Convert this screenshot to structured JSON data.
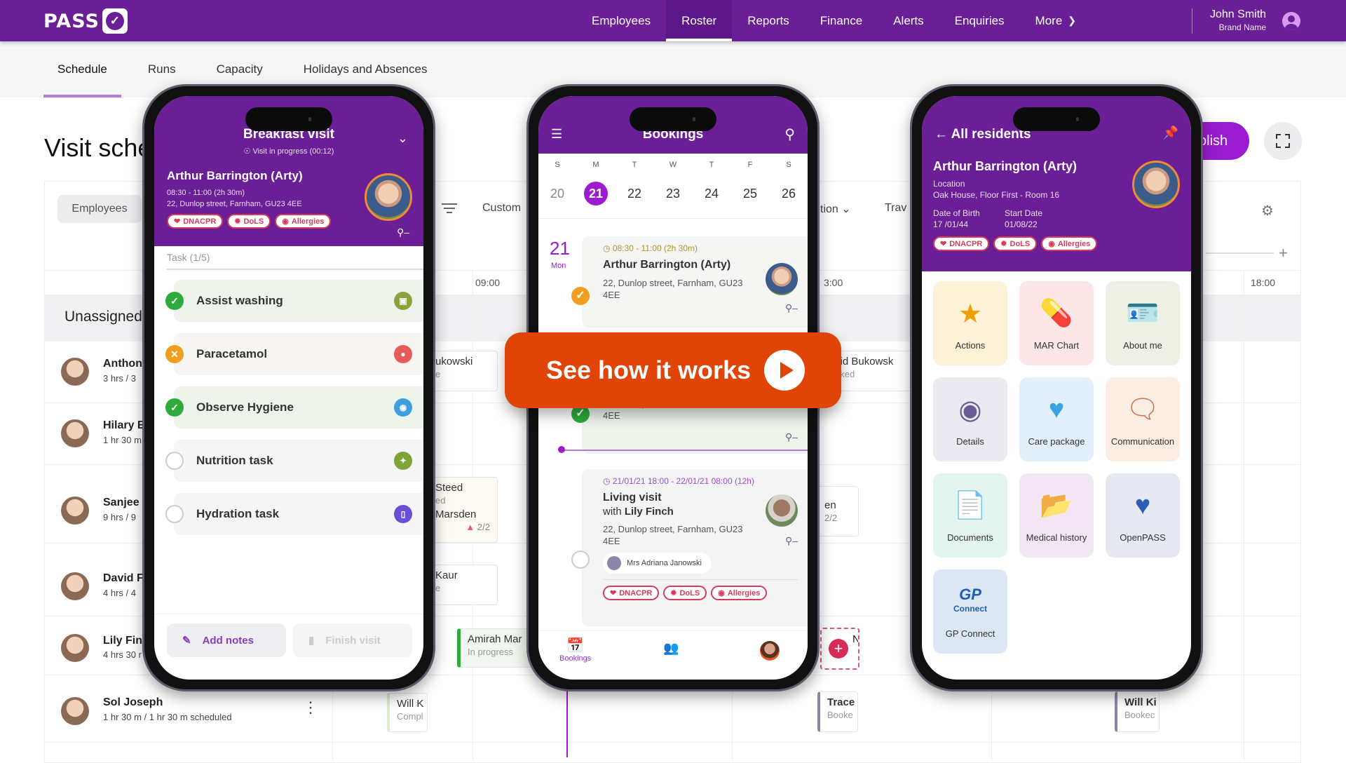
{
  "app": {
    "logo_text": "PASS",
    "logo_mark": "✓"
  },
  "nav": {
    "items": [
      "Employees",
      "Roster",
      "Reports",
      "Finance",
      "Alerts",
      "Enquiries",
      "More"
    ],
    "active": "Roster",
    "more_icon": "chevron-down"
  },
  "user": {
    "name": "John Smith",
    "brand": "Brand Name",
    "icon": "user-circle"
  },
  "tabs": {
    "items": [
      "Schedule",
      "Runs",
      "Capacity",
      "Holidays and Absences"
    ],
    "active": "Schedule"
  },
  "page": {
    "title": "Visit sche",
    "publish_label": "olish",
    "fullscreen_icon": "expand-icon"
  },
  "toolbar": {
    "employees_label": "Employees",
    "customise_label": "Custom",
    "location_label": "tion",
    "travel_label": "Trav"
  },
  "timeline": {
    "labels": [
      "09:00",
      "3:00",
      "18:00"
    ]
  },
  "unassigned_label": "Unassigned",
  "employees": [
    {
      "name": "Anthon",
      "hours": "3 hrs / 3"
    },
    {
      "name": "Hilary E",
      "hours": "1 hr 30 m"
    },
    {
      "name": "Sanjee",
      "hours": "9 hrs / 9"
    },
    {
      "name": "David F",
      "hours": "4 hrs / 4"
    },
    {
      "name": "Lily Fin",
      "hours": "4 hrs 30 r"
    },
    {
      "name": "Sol Joseph",
      "hours": "1 hr 30 m / 1 hr 30 m scheduled"
    }
  ],
  "blocks": {
    "b1": {
      "title": "ukowski",
      "status": "e"
    },
    "b2": {
      "title": "vid Bukowsk",
      "status": "oked"
    },
    "b3": {
      "title": "Steed",
      "status": "ed",
      "title2": "Marsden",
      "count": "2/2"
    },
    "b4": {
      "title": "en",
      "count": "2/2"
    },
    "b5": {
      "title": "Kaur",
      "status": "e"
    },
    "b6": {
      "title": "Amirah Mar",
      "status": "In progress"
    },
    "b7": {
      "title": "N"
    },
    "b8": {
      "title": "Will K",
      "status": "Compl"
    },
    "b9": {
      "title": "Trace",
      "status": "Booke"
    },
    "b10": {
      "title": "Will Ki",
      "status": "Bookec"
    }
  },
  "phone1": {
    "title": "Breakfast visit",
    "status": "Visit in progress (00:12)",
    "client": "Arthur Barrington (Arty)",
    "time": "08:30 - 11:00 (2h 30m)",
    "address": "22, Dunlop street, Farnham, GU23 4EE",
    "chips": [
      "DNACPR",
      "DoLS",
      "Allergies"
    ],
    "task_header": "Task (1/5)",
    "tasks": [
      {
        "label": "Assist washing",
        "state": "done",
        "color": "#8aa33a"
      },
      {
        "label": "Paracetamol",
        "state": "refused",
        "color": "#e85a5a"
      },
      {
        "label": "Observe Hygiene",
        "state": "done-late",
        "color": "#3d9ee0"
      },
      {
        "label": "Nutrition task",
        "state": "pending",
        "color": "#7ea338"
      },
      {
        "label": "Hydration task",
        "state": "pending",
        "color": "#6a4fd6"
      }
    ],
    "add_notes": "Add notes",
    "finish_visit": "Finish visit"
  },
  "phone2": {
    "title": "Bookings",
    "days": [
      "S",
      "M",
      "T",
      "W",
      "T",
      "F",
      "S"
    ],
    "dates": [
      "20",
      "21",
      "22",
      "23",
      "24",
      "25",
      "26"
    ],
    "selected_date": "21",
    "side_day": "21",
    "side_dow": "Mon",
    "booking1": {
      "time": "08:30 - 11:00 (2h 30m)",
      "name": "Arthur Barrington (Arty)",
      "address": "22, Dunlop street, Farnham, GU23 4EE"
    },
    "booking2": {
      "address": "22, Dunlop street, Farnham, GU23 4EE"
    },
    "booking3": {
      "time": "21/01/21 18:00 - 22/01/21 08:00 (12h)",
      "title": "Living visit",
      "with_prefix": "with ",
      "with_name": "Lily Finch",
      "address": "22, Dunlop street, Farnham, GU23 4EE",
      "carer": "Mrs Adriana Janowski",
      "chips": [
        "DNACPR",
        "DoLS",
        "Allergies"
      ]
    },
    "bottom_nav": {
      "bookings": "Bookings"
    }
  },
  "phone3": {
    "back_label": "All residents",
    "name": "Arthur Barrington (Arty)",
    "location_label": "Location",
    "location": "Oak House, Floor First - Room 16",
    "dob_label": "Date of Birth",
    "dob": "17 /01/44",
    "start_label": "Start Date",
    "start": "01/08/22",
    "chips": [
      "DNACPR",
      "DoLS",
      "Allergies"
    ],
    "tiles": [
      {
        "label": "Actions",
        "icon": "★",
        "bg": "#fdf1d8",
        "color": "#f0a000"
      },
      {
        "label": "MAR Chart",
        "icon": "💊",
        "bg": "#fce6e8",
        "color": "#e55a5a"
      },
      {
        "label": "About me",
        "icon": "🪪",
        "bg": "#eef0e6",
        "color": "#7ea338"
      },
      {
        "label": "Details",
        "icon": "◉",
        "bg": "#ebeaf0",
        "color": "#6b5b93"
      },
      {
        "label": "Care package",
        "icon": "♥",
        "bg": "#e3effa",
        "color": "#3aa3e0"
      },
      {
        "label": "Communication",
        "icon": "🗨",
        "bg": "#fbece4",
        "color": "#c8754a"
      },
      {
        "label": "Documents",
        "icon": "📄",
        "bg": "#e3f5ee",
        "color": "#3bb98a"
      },
      {
        "label": "Medical history",
        "icon": "📂",
        "bg": "#f3e7f5",
        "color": "#b063c9"
      },
      {
        "label": "OpenPASS",
        "icon": "♥",
        "bg": "#e6e8f2",
        "color": "#2c5fb3"
      },
      {
        "label": "GP Connect",
        "icon": "GP",
        "bg": "#dde7f3",
        "color": "#1d5fb0"
      }
    ],
    "gp_sub": "Connect"
  },
  "cta": {
    "label": "See how it works",
    "icon": "play-icon",
    "color": "#e04406"
  },
  "colors": {
    "brand": "#6a1f97",
    "accent": "#9b1bd0",
    "alert": "#d53c59"
  }
}
